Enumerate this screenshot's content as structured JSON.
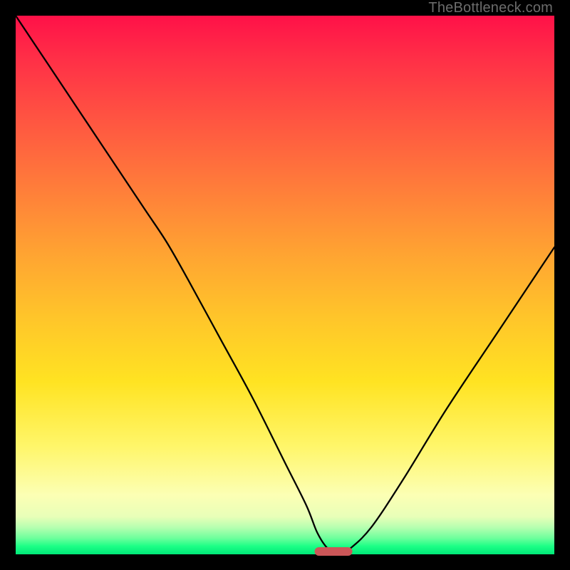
{
  "watermark": "TheBottleneck.com",
  "colors": {
    "frame": "#000000",
    "gradient_top": "#ff1148",
    "gradient_bottom": "#00e878",
    "curve": "#000000",
    "marker": "#cb5658",
    "watermark": "#6c6c6c"
  },
  "chart_data": {
    "type": "line",
    "title": "",
    "xlabel": "",
    "ylabel": "",
    "xlim": [
      0,
      100
    ],
    "ylim": [
      0,
      100
    ],
    "annotations": [
      {
        "text": "TheBottleneck.com",
        "position": "top-right"
      }
    ],
    "marker": {
      "x": 59,
      "y": 0,
      "width": 7,
      "shape": "pill",
      "color": "#cb5658"
    },
    "series": [
      {
        "name": "bottleneck-curve",
        "x": [
          0,
          6,
          12,
          18,
          24,
          28,
          32,
          38,
          44,
          50,
          54,
          56,
          58,
          60,
          62,
          66,
          72,
          80,
          90,
          100
        ],
        "y": [
          100,
          91,
          82,
          73,
          64,
          58,
          51,
          40,
          29,
          17,
          9,
          4,
          1,
          0,
          1,
          5,
          14,
          27,
          42,
          57
        ]
      }
    ]
  }
}
